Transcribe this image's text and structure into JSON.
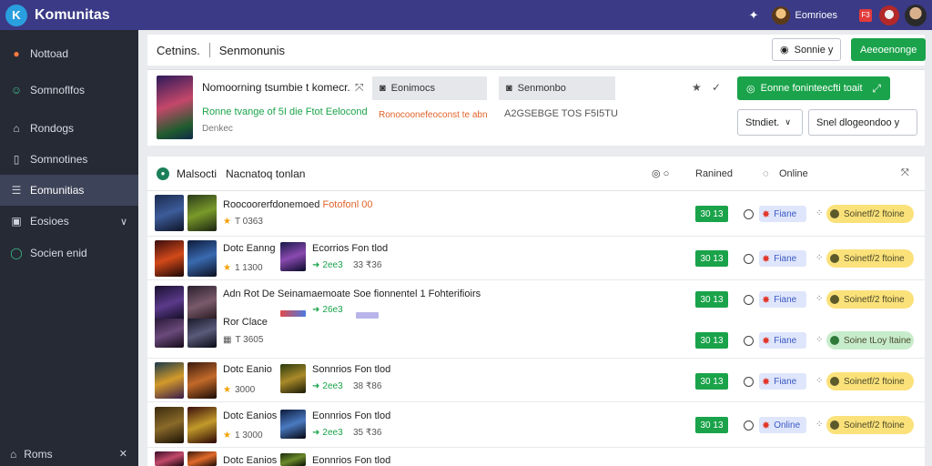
{
  "app": {
    "name": "Komunitas"
  },
  "topbar": {
    "user_name": "Eomrioes",
    "notif_count": "F3"
  },
  "sidebar": {
    "items": [
      {
        "label": "Nottoad",
        "icon": "record-icon",
        "active": false
      },
      {
        "label": "Somnoflfos",
        "icon": "people-icon",
        "active": false
      },
      {
        "label": "Rondogs",
        "icon": "cart-icon",
        "active": false
      },
      {
        "label": "Somnotines",
        "icon": "book-icon",
        "active": false
      },
      {
        "label": "Eomunitias",
        "icon": "list-icon",
        "active": true
      },
      {
        "label": "Eosioes",
        "icon": "media-icon",
        "active": false
      },
      {
        "label": "Socien enid",
        "icon": "circle-icon",
        "active": false
      }
    ],
    "bottom": {
      "label": "Roms"
    }
  },
  "header": {
    "title": "Cetnins.",
    "subtitle": "Senmonunis",
    "search_button": "Sonnie y",
    "primary_button": "Aeeoenonge"
  },
  "featured": {
    "title": "Nomoorning tsumbie t komecr.",
    "green_text": "Ronne tvange of 5I die Ftot Eelocond",
    "small_text": "Denkec",
    "pill_1": "Eonimocs",
    "pill_2": "Senmonbo",
    "orange_text": "Ronocoonefeoconst te abn",
    "gray_text": "A2GSEBGE TOS F5I5TU",
    "download_button": "Eonne foninteecfti toait",
    "dropdown_1": "Stndiet.",
    "dropdown_2": "Snel dlogeondoo y"
  },
  "listing": {
    "title": "Malsocti",
    "subtitle": "Nacnatoq tonlan",
    "col_ranked": "Ranined",
    "col_online": "Online",
    "rows": [
      {
        "name": "Roocoorerfdonemoed",
        "name_accent": "Fotofonl 00",
        "rating": "T 0363",
        "second_name": "",
        "second_green": "",
        "second_count": "",
        "badge": "30 13",
        "chip": "Fiane",
        "pill": "Soinetf/2 ftoine",
        "mint": false
      },
      {
        "name": "Dotc Eanng",
        "name_accent": "",
        "rating": "1 1300",
        "second_name": "Ecorrios Fon tlod",
        "second_green": "2ee3",
        "second_count": "33 ₹36",
        "badge": "30 13",
        "chip": "Fiane",
        "pill": "Soinetf/2 ftoine",
        "mint": false
      },
      {
        "name": "Adn Rot De Seinamaemoate Soe fionnentel 1 Fohterifioirs",
        "name_accent": "",
        "rating": "",
        "second_name": "",
        "second_green": "26e3",
        "second_count": "",
        "badge": "30 13",
        "chip": "Fiane",
        "pill": "Soinetf/2 ftoine",
        "mint": false
      },
      {
        "name": "Ror Clace",
        "name_accent": "",
        "rating": "T 3605",
        "second_name": "",
        "second_green": "",
        "second_count": "",
        "badge": "30 13",
        "chip": "Fiane",
        "pill": "Soine tLoy ltaine",
        "mint": true
      },
      {
        "name": "Dotc Eanio",
        "name_accent": "",
        "rating": "3000",
        "second_name": "Sonnrios Fon tlod",
        "second_green": "2ee3",
        "second_count": "38 ₹86",
        "badge": "30 13",
        "chip": "Fiane",
        "pill": "Soinetf/2 ftoine",
        "mint": false
      },
      {
        "name": "Dotc Eanios",
        "name_accent": "",
        "rating": "1 3000",
        "second_name": "Eonnrios Fon tlod",
        "second_green": "2ee3",
        "second_count": "35 ₹36",
        "badge": "30 13",
        "chip": "Online",
        "pill": "Soinetf/2 ftoine",
        "mint": false
      },
      {
        "name": "Dotc Eanios",
        "name_accent": "",
        "rating": "",
        "second_name": "Eonnrios Fon tlod",
        "second_green": "",
        "second_count": "",
        "badge": "",
        "chip": "",
        "pill": "",
        "mint": false
      }
    ]
  },
  "colors": {
    "topbar": "#3a3a86",
    "sidebar": "#262a35",
    "accent_green": "#1aa34a",
    "accent_orange": "#e2632a",
    "chip_yellow": "#fbe17a"
  }
}
